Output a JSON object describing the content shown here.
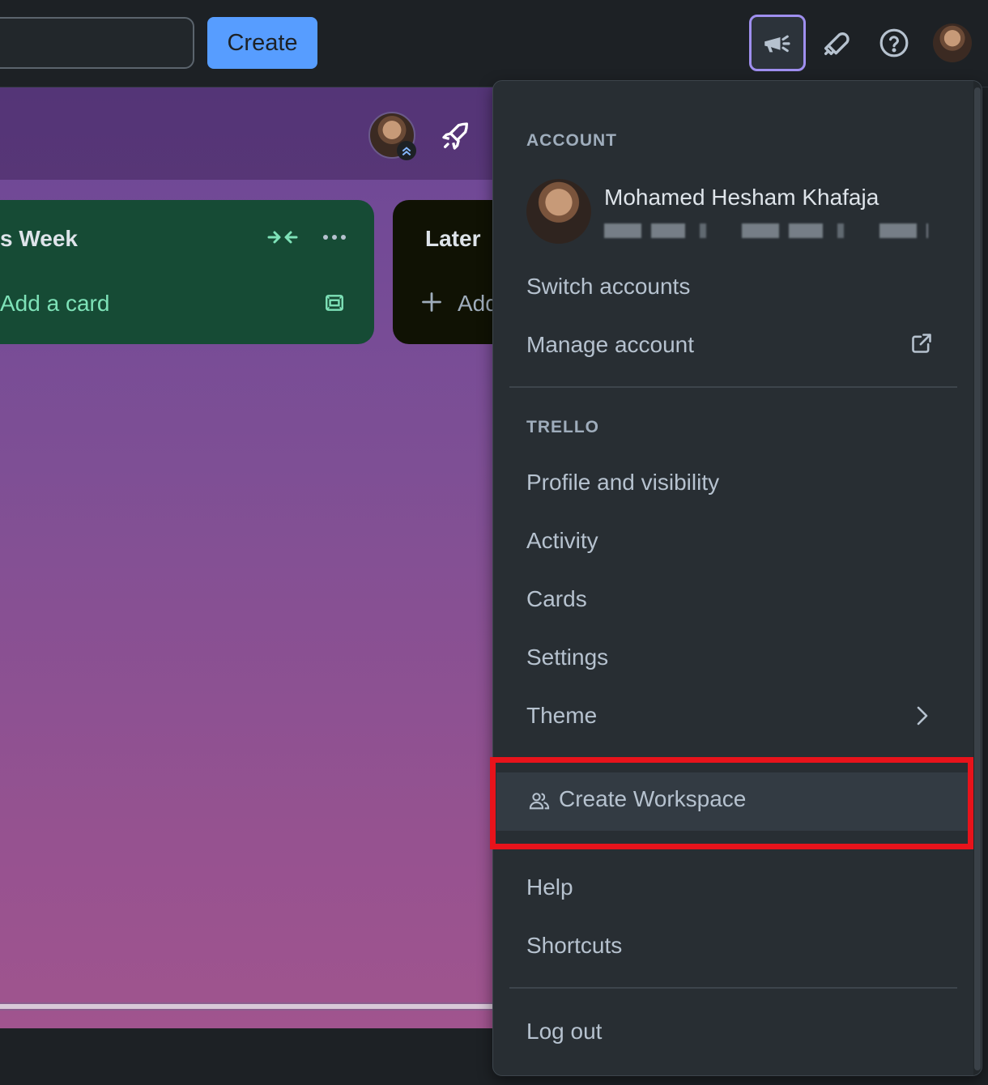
{
  "header": {
    "create_label": "Create"
  },
  "board": {
    "lists": [
      {
        "title": "s Week",
        "add_card_label": "Add a card"
      },
      {
        "title": "Later",
        "add_card_label": "Add"
      }
    ]
  },
  "menu": {
    "account_heading": "ACCOUNT",
    "user_name": "Mohamed Hesham Khafaja",
    "switch_accounts": "Switch accounts",
    "manage_account": "Manage account",
    "trello_heading": "TRELLO",
    "profile_visibility": "Profile and visibility",
    "activity": "Activity",
    "cards": "Cards",
    "settings": "Settings",
    "theme": "Theme",
    "create_workspace": "Create Workspace",
    "help": "Help",
    "shortcuts": "Shortcuts",
    "log_out": "Log out"
  },
  "colors": {
    "accent_blue": "#579dff",
    "list_green": "#164b35",
    "highlight_red": "#e8131b",
    "menu_bg": "#282e33"
  },
  "icons": [
    "megaphone-icon",
    "bell-icon",
    "help-icon",
    "rocket-icon",
    "collapse-icon",
    "more-icon",
    "template-icon",
    "plus-icon",
    "external-link-icon",
    "chevron-right-icon",
    "workspace-icon"
  ]
}
